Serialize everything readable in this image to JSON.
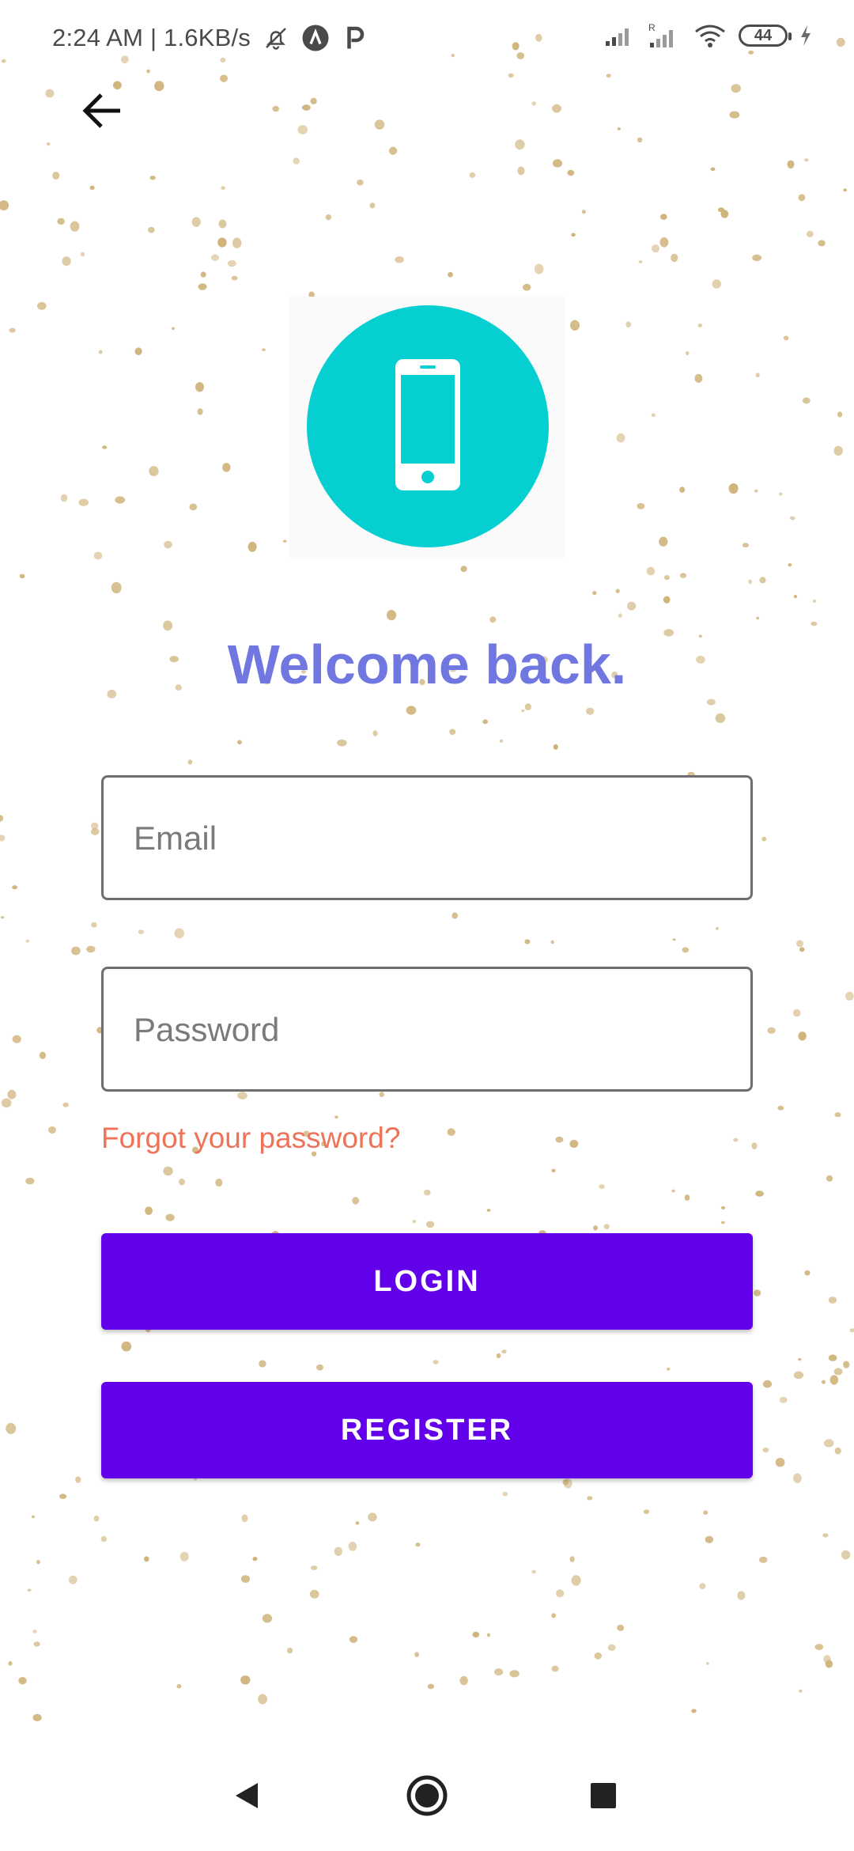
{
  "status_bar": {
    "time_speed": "2:24 AM | 1.6KB/s",
    "battery": "44",
    "icons": [
      "mute-bell-icon",
      "a-circle-icon",
      "p-icon",
      "signal-icon",
      "signal-roaming-icon",
      "wifi-icon",
      "battery-icon",
      "charging-icon"
    ]
  },
  "header": {
    "back_icon": "arrow-left-icon"
  },
  "logo": {
    "icon": "smartphone-icon",
    "circle_color": "#06cfd1"
  },
  "title": "Welcome back.",
  "form": {
    "email": {
      "value": "",
      "placeholder": "Email"
    },
    "password": {
      "value": "",
      "placeholder": "Password"
    },
    "forgot_link": "Forgot your password?"
  },
  "buttons": {
    "login": "LOGIN",
    "register": "REGISTER"
  },
  "colors": {
    "primary": "#6200ea",
    "title": "#7077e0",
    "link": "#ee7358",
    "speckle": "#cfb37a"
  },
  "nav": {
    "back": "back-triangle-icon",
    "home": "home-circle-icon",
    "recents": "recents-square-icon"
  }
}
